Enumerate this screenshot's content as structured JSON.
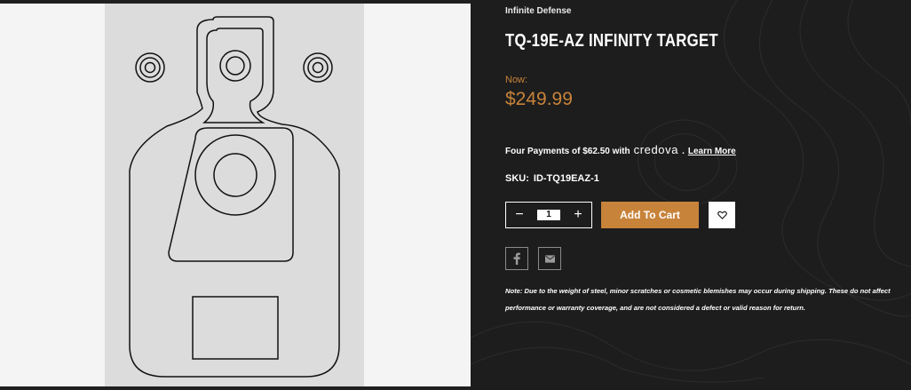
{
  "product": {
    "brand": "Infinite Defense",
    "title": "TQ-19E-AZ INFINITY TARGET",
    "price_label": "Now:",
    "price": "$249.99",
    "financing": {
      "text": "Four Payments of $62.50 with",
      "provider": "credova",
      "separator": ".",
      "link": "Learn More"
    },
    "sku_label": "SKU:",
    "sku": "ID-TQ19EAZ-1",
    "quantity": "1",
    "quantity_minus": "−",
    "quantity_plus": "+",
    "add_to_cart_label": "Add To Cart",
    "note": "Note: Due to the weight of steel, minor scratches or cosmetic blemishes may occur during shipping. These do not affect performance or warranty coverage, and are not considered a defect or valid reason for return."
  },
  "icons": {
    "wishlist": "heart-icon",
    "share_facebook": "facebook-icon",
    "share_email": "email-icon"
  },
  "colors": {
    "accent": "#c8833a",
    "background": "#1d1d1d",
    "target_board": "#dcdcdc"
  }
}
